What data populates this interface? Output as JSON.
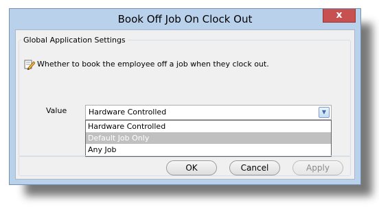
{
  "dialog": {
    "title": "Book Off Job On Clock Out",
    "close_label": "x"
  },
  "group": {
    "title": "Global Application Settings",
    "description": "Whether to book the employee off a job when they clock out."
  },
  "field": {
    "label": "Value",
    "selected": "Hardware Controlled",
    "options": [
      "Hardware Controlled",
      "Default Job Only",
      "Any Job"
    ],
    "highlighted_option": "Default Job Only"
  },
  "buttons": {
    "ok": "OK",
    "cancel": "Cancel",
    "apply": "Apply"
  },
  "icons": {
    "description_icon": "pencil-icon",
    "combo_arrow": "chevron-down-icon"
  },
  "colors": {
    "window_frame": "#b9d1ea",
    "close_button": "#c75050",
    "highlight": "#c0c0c0"
  }
}
